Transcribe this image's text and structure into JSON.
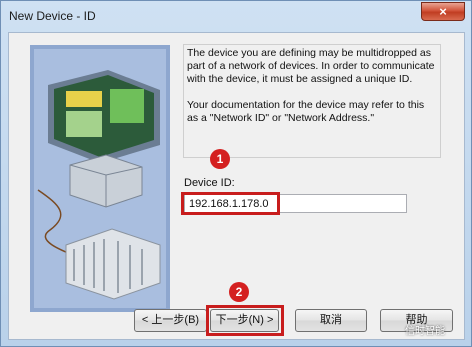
{
  "window": {
    "title": "New Device - ID",
    "close_glyph": "×"
  },
  "description": {
    "paragraph1": "The device you are defining may be multidropped as part of a network of devices.  In order to communicate with the device, it must be assigned a unique ID.",
    "paragraph2": "Your documentation for the device may refer to this as a \"Network ID\" or \"Network Address.\""
  },
  "device_id": {
    "label": "Device ID:",
    "value": "192.168.1.178.0"
  },
  "annotations": {
    "badge1": "1",
    "badge2": "2",
    "highlight_color": "#c81d1d"
  },
  "buttons": {
    "back": "< 上一步(B)",
    "next": "下一步(N) >",
    "cancel": "取消",
    "help": "帮助"
  },
  "watermark": "信时智能"
}
